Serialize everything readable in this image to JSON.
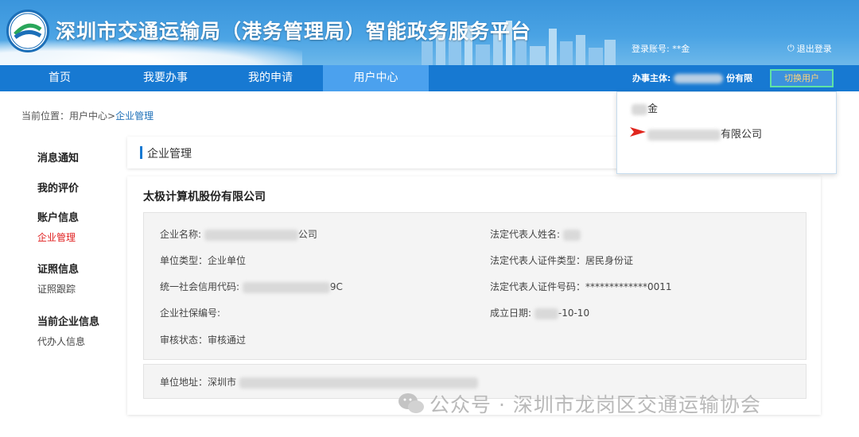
{
  "header": {
    "site_title": "深圳市交通运输局（港务管理局）智能政务服务平台",
    "login_label": "登录账号: **金",
    "logout_label": "退出登录"
  },
  "nav": {
    "items": [
      "首页",
      "我要办事",
      "我的申请",
      "用户中心"
    ],
    "active": "用户中心",
    "subject_label": "办事主体:",
    "subject_suffix": "份有限",
    "switch_label": "切换用户"
  },
  "dropdown": {
    "items": [
      {
        "suffix": "金"
      },
      {
        "suffix": "有限公司"
      }
    ]
  },
  "breadcrumb": {
    "prefix": "当前位置：用户中心>",
    "current": "企业管理"
  },
  "left_menu": {
    "items": [
      "消息通知",
      "我的评价",
      "账户信息",
      "企业管理",
      "证照信息",
      "证照跟踪",
      "当前企业信息",
      "代办人信息"
    ]
  },
  "page": {
    "section_title": "企业管理",
    "company_name": "太极计算机股份有限公司"
  },
  "fields": {
    "company_name_label": "企业名称:",
    "company_name_suffix": "公司",
    "unit_type": "单位类型：企业单位",
    "credit_code_label": "统一社会信用代码:",
    "credit_code_suffix": "9C",
    "social_security": "企业社保编号:",
    "review_status": "审核状态：审核通过",
    "legal_name_label": "法定代表人姓名:",
    "legal_id_type": "法定代表人证件类型：居民身份证",
    "legal_id_number": "法定代表人证件号码：*************0011",
    "established_label": "成立日期:",
    "established_suffix": "-10-10",
    "address_label": "单位地址：深圳市"
  },
  "watermark": {
    "text": "公众号 · 深圳市龙岗区交通运输协会"
  },
  "colors": {
    "nav_bg": "#1779d2",
    "nav_active": "#4ba1ee",
    "menu_active": "#e02020",
    "switch_border": "#5fe3a4"
  }
}
